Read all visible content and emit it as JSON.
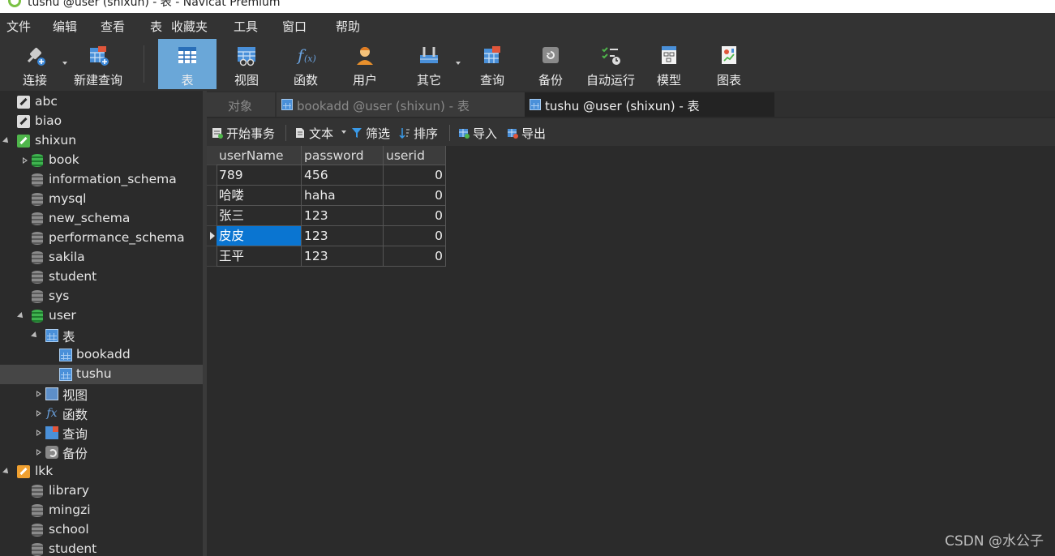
{
  "window": {
    "title": "tushu @user (shixun) - 表 - Navicat Premium"
  },
  "menu": [
    "文件",
    "编辑",
    "查看",
    "表",
    "收藏夹",
    "工具",
    "窗口",
    "帮助"
  ],
  "toolbar": [
    {
      "label": "连接",
      "icon": "plug-icon"
    },
    {
      "label": "新建查询",
      "icon": "new-query-icon"
    },
    {
      "label": "表",
      "icon": "table-icon",
      "active": true
    },
    {
      "label": "视图",
      "icon": "view-icon"
    },
    {
      "label": "函数",
      "icon": "function-icon"
    },
    {
      "label": "用户",
      "icon": "user-icon"
    },
    {
      "label": "其它",
      "icon": "tools-icon"
    },
    {
      "label": "查询",
      "icon": "query-icon"
    },
    {
      "label": "备份",
      "icon": "backup-icon"
    },
    {
      "label": "自动运行",
      "icon": "automation-icon"
    },
    {
      "label": "模型",
      "icon": "model-icon"
    },
    {
      "label": "图表",
      "icon": "chart-icon"
    }
  ],
  "tree": [
    {
      "label": "abc",
      "type": "connection",
      "level": 0
    },
    {
      "label": "biao",
      "type": "connection",
      "level": 0
    },
    {
      "label": "shixun",
      "type": "connection-green",
      "level": 0,
      "expanded": true
    },
    {
      "label": "book",
      "type": "database-green",
      "level": 1,
      "collapsed": true
    },
    {
      "label": "information_schema",
      "type": "database",
      "level": 1
    },
    {
      "label": "mysql",
      "type": "database",
      "level": 1
    },
    {
      "label": "new_schema",
      "type": "database",
      "level": 1
    },
    {
      "label": "performance_schema",
      "type": "database",
      "level": 1
    },
    {
      "label": "sakila",
      "type": "database",
      "level": 1
    },
    {
      "label": "student",
      "type": "database",
      "level": 1
    },
    {
      "label": "sys",
      "type": "database",
      "level": 1
    },
    {
      "label": "user",
      "type": "database-green",
      "level": 1,
      "expanded": true
    },
    {
      "label": "表",
      "type": "table-folder",
      "level": 2,
      "expanded": true
    },
    {
      "label": "bookadd",
      "type": "table",
      "level": 3
    },
    {
      "label": "tushu",
      "type": "table",
      "level": 3,
      "selected": true
    },
    {
      "label": "视图",
      "type": "view-folder",
      "level": 2,
      "collapsed": true
    },
    {
      "label": "函数",
      "type": "function-folder",
      "level": 2,
      "collapsed": true
    },
    {
      "label": "查询",
      "type": "query-folder",
      "level": 2,
      "collapsed": true
    },
    {
      "label": "备份",
      "type": "backup-folder",
      "level": 2,
      "collapsed": true
    },
    {
      "label": "lkk",
      "type": "connection-orange",
      "level": 0,
      "expanded": true
    },
    {
      "label": "library",
      "type": "database",
      "level": 1
    },
    {
      "label": "mingzi",
      "type": "database",
      "level": 1
    },
    {
      "label": "school",
      "type": "database",
      "level": 1
    },
    {
      "label": "student",
      "type": "database",
      "level": 1
    }
  ],
  "tabs": [
    {
      "label": "对象",
      "active": false
    },
    {
      "label": "bookadd @user (shixun) - 表",
      "active": false
    },
    {
      "label": "tushu @user (shixun) - 表",
      "active": true
    }
  ],
  "subtoolbar": {
    "begin_tx": "开始事务",
    "text": "文本",
    "filter": "筛选",
    "sort": "排序",
    "import": "导入",
    "export": "导出"
  },
  "grid": {
    "columns": [
      "userName",
      "password",
      "userid"
    ],
    "rows": [
      [
        "789",
        "456",
        "0"
      ],
      [
        "哈喽",
        "haha",
        "0"
      ],
      [
        "张三",
        "123",
        "0"
      ],
      [
        "皮皮",
        "123",
        "0"
      ],
      [
        "王平",
        "123",
        "0"
      ]
    ],
    "current_row": 3
  },
  "watermark": "CSDN @水公子"
}
